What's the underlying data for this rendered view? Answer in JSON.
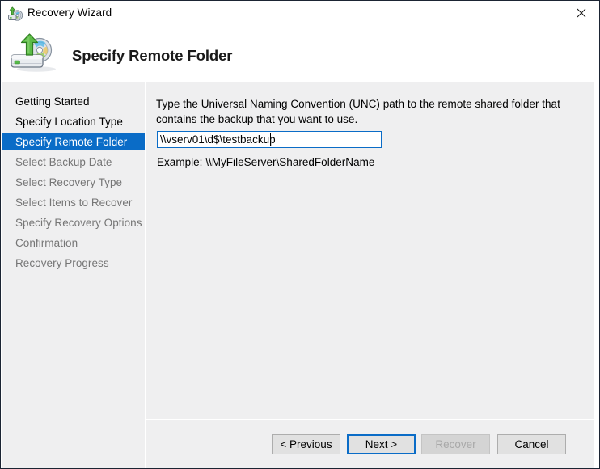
{
  "window": {
    "title": "Recovery Wizard",
    "title_icon": "recovery-disc-icon",
    "close_icon": "close-icon"
  },
  "header": {
    "title": "Specify Remote Folder",
    "icon": "backup-drive-restore-icon"
  },
  "sidebar": {
    "items": [
      {
        "label": "Getting Started",
        "state": "done"
      },
      {
        "label": "Specify Location Type",
        "state": "done"
      },
      {
        "label": "Specify Remote Folder",
        "state": "current"
      },
      {
        "label": "Select Backup Date",
        "state": "upcoming"
      },
      {
        "label": "Select Recovery Type",
        "state": "upcoming"
      },
      {
        "label": "Select Items to Recover",
        "state": "upcoming"
      },
      {
        "label": "Specify Recovery Options",
        "state": "upcoming"
      },
      {
        "label": "Confirmation",
        "state": "upcoming"
      },
      {
        "label": "Recovery Progress",
        "state": "upcoming"
      }
    ]
  },
  "main": {
    "instruction": "Type the Universal Naming Convention (UNC) path to the remote shared folder that contains the backup that you want to use.",
    "unc_path_value": "\\\\vserv01\\d$\\testbackup",
    "unc_path_placeholder": "",
    "example": "Example: \\\\MyFileServer\\SharedFolderName"
  },
  "footer": {
    "previous_label": "< Previous",
    "next_label": "Next >",
    "recover_label": "Recover",
    "cancel_label": "Cancel",
    "recover_enabled": false
  },
  "colors": {
    "accent": "#0a6cc7",
    "panel": "#efeff0",
    "window_border": "#1b2433",
    "disabled_text": "#a9a9a9",
    "muted_text": "#767676"
  }
}
